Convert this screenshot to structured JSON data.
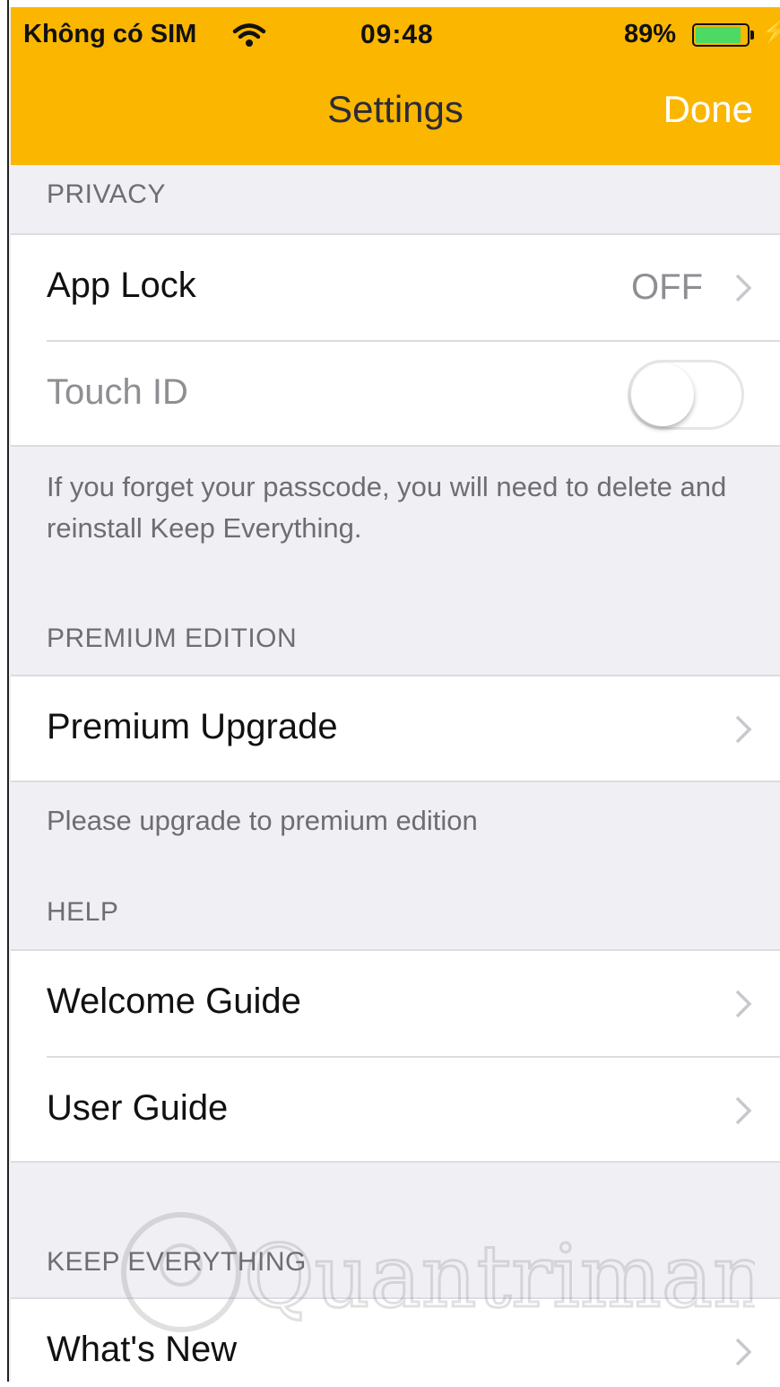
{
  "status_bar": {
    "carrier": "Không có SIM",
    "time": "09:48",
    "battery_percent": "89%",
    "battery_level": 0.89,
    "battery_color": "#4cd964"
  },
  "nav": {
    "title": "Settings",
    "done_label": "Done",
    "bar_color": "#fbb600"
  },
  "sections": {
    "privacy": {
      "header": "PRIVACY",
      "app_lock_label": "App Lock",
      "app_lock_value": "OFF",
      "touch_id_label": "Touch ID",
      "touch_id_on": false,
      "footer": "If you forget your passcode, you will need to delete and reinstall Keep Everything."
    },
    "premium": {
      "header": "PREMIUM EDITION",
      "upgrade_label": "Premium Upgrade",
      "footer": "Please upgrade to premium edition"
    },
    "help": {
      "header": "HELP",
      "welcome_label": "Welcome Guide",
      "user_guide_label": "User Guide"
    },
    "keep_everything": {
      "header": "KEEP EVERYTHING",
      "whats_new_label": "What's New"
    }
  },
  "icons": [
    "wifi-icon",
    "battery-icon",
    "charging-bolt-icon",
    "chevron-right-icon",
    "watermark-logo-icon"
  ],
  "watermark": {
    "text": "Quantrimang"
  }
}
